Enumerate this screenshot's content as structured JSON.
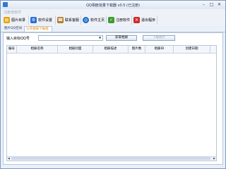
{
  "window": {
    "title": "QQ相册批量下载器 v0.5 (已注册)"
  },
  "menubar": {
    "items": [
      "注册该软件"
    ]
  },
  "toolbar": {
    "buttons": [
      {
        "label": "图片目录",
        "icon": "folder-icon",
        "color": "#e6a200"
      },
      {
        "label": "软件设置",
        "icon": "settings-icon",
        "color": "#2a6fd6"
      },
      {
        "label": "联系客服",
        "icon": "contacts-icon",
        "color": "#b57a2a"
      },
      {
        "label": "软件主页",
        "icon": "globe-icon",
        "color": "#1b6ac9"
      },
      {
        "label": "注册软件",
        "icon": "register-icon",
        "color": "#3f9b2f"
      },
      {
        "label": "退出程序",
        "icon": "exit-icon",
        "color": "#d02a2a"
      }
    ]
  },
  "tabs": [
    {
      "label": "图片QQ空间"
    },
    {
      "label": "公开相册下载相册"
    }
  ],
  "form": {
    "label": "输入目标QQ号",
    "combo_value": "",
    "get_button": "获取相册",
    "download_button": "下载图片"
  },
  "table": {
    "columns": [
      "编号",
      "相册名称",
      "相册封面",
      "相册描述",
      "图片数",
      "相册ID",
      "创建日期"
    ]
  }
}
